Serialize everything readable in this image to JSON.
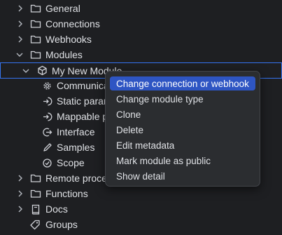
{
  "tree": {
    "items": [
      {
        "label": "General",
        "icon": "folder-icon"
      },
      {
        "label": "Connections",
        "icon": "folder-icon"
      },
      {
        "label": "Webhooks",
        "icon": "folder-icon"
      },
      {
        "label": "Modules",
        "icon": "folder-icon"
      },
      {
        "label": "My New Module",
        "icon": "module-cube-icon"
      },
      {
        "label": "Communica",
        "icon": "gear-icon"
      },
      {
        "label": "Static paran",
        "icon": "arrow-in-circle-icon"
      },
      {
        "label": "Mappable p",
        "icon": "arrow-in-circle-icon"
      },
      {
        "label": "Interface",
        "icon": "arrow-out-circle-icon"
      },
      {
        "label": "Samples",
        "icon": "pen-icon"
      },
      {
        "label": "Scope",
        "icon": "check-circle-icon"
      },
      {
        "label": "Remote proce",
        "icon": "folder-icon"
      },
      {
        "label": "Functions",
        "icon": "folder-icon"
      },
      {
        "label": "Docs",
        "icon": "book-icon"
      },
      {
        "label": "Groups",
        "icon": "tag-icon"
      }
    ]
  },
  "context_menu": {
    "items": [
      {
        "label": "Change connection or webhook"
      },
      {
        "label": "Change module type"
      },
      {
        "label": "Clone"
      },
      {
        "label": "Delete"
      },
      {
        "label": "Edit metadata"
      },
      {
        "label": "Mark module as public"
      },
      {
        "label": "Show detail"
      }
    ]
  },
  "colors": {
    "background": "#1e1f22",
    "text": "#dfe1e5",
    "selection_border": "#3574f0",
    "menu_background": "#2b2d30",
    "menu_highlight": "#2e55c3"
  }
}
